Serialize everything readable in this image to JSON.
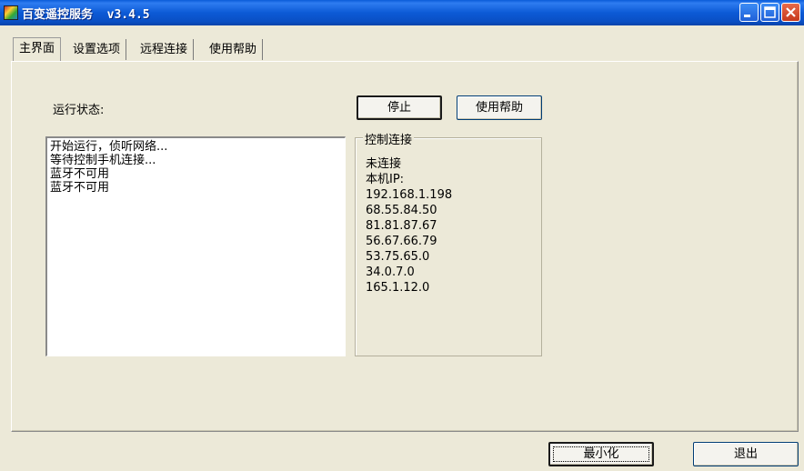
{
  "window": {
    "title": "百变遥控服务  v3.4.5",
    "icon": "app-icon"
  },
  "window_controls": [
    "minimize-icon",
    "maximize-icon",
    "close-icon"
  ],
  "tabs": [
    {
      "label": "主界面",
      "active": true
    },
    {
      "label": "设置选项",
      "active": false
    },
    {
      "label": "远程连接",
      "active": false
    },
    {
      "label": "使用帮助",
      "active": false
    }
  ],
  "main": {
    "status_label": "运行状态:",
    "stop_button": "停止",
    "help_button": "使用帮助",
    "log_lines": [
      "开始运行，侦听网络...",
      "等待控制手机连接...",
      "蓝牙不可用",
      "蓝牙不可用"
    ],
    "control_group": {
      "title": "控制连接",
      "connection_status": "未连接",
      "ip_label": "本机IP:",
      "ips": [
        "192.168.1.198",
        "68.55.84.50",
        "81.81.87.67",
        "56.67.66.79",
        "53.75.65.0",
        "34.0.7.0",
        "165.1.12.0"
      ]
    }
  },
  "footer": {
    "minimize_button": "最小化",
    "exit_button": "退出"
  }
}
